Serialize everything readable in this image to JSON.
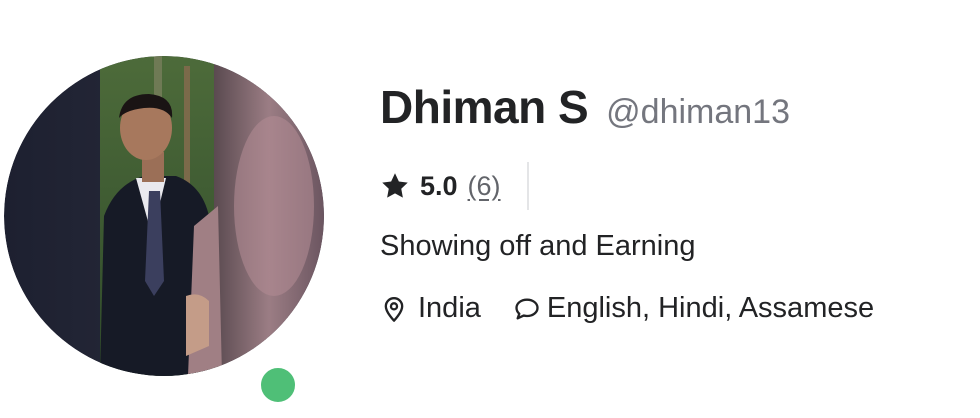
{
  "profile": {
    "display_name": "Dhiman S",
    "username": "@dhiman13",
    "online": true,
    "avatar_alt": "profile photo",
    "rating": {
      "value": "5.0",
      "count": "(6)"
    },
    "tagline": "Showing off and Earning",
    "location": "India",
    "languages": "English, Hindi, Assamese"
  },
  "colors": {
    "online_dot": "#4fbf77",
    "text_primary": "#222325",
    "text_secondary": "#74767e"
  },
  "icons": {
    "rating": "star-icon",
    "location": "map-pin-icon",
    "languages": "chat-bubble-icon"
  }
}
